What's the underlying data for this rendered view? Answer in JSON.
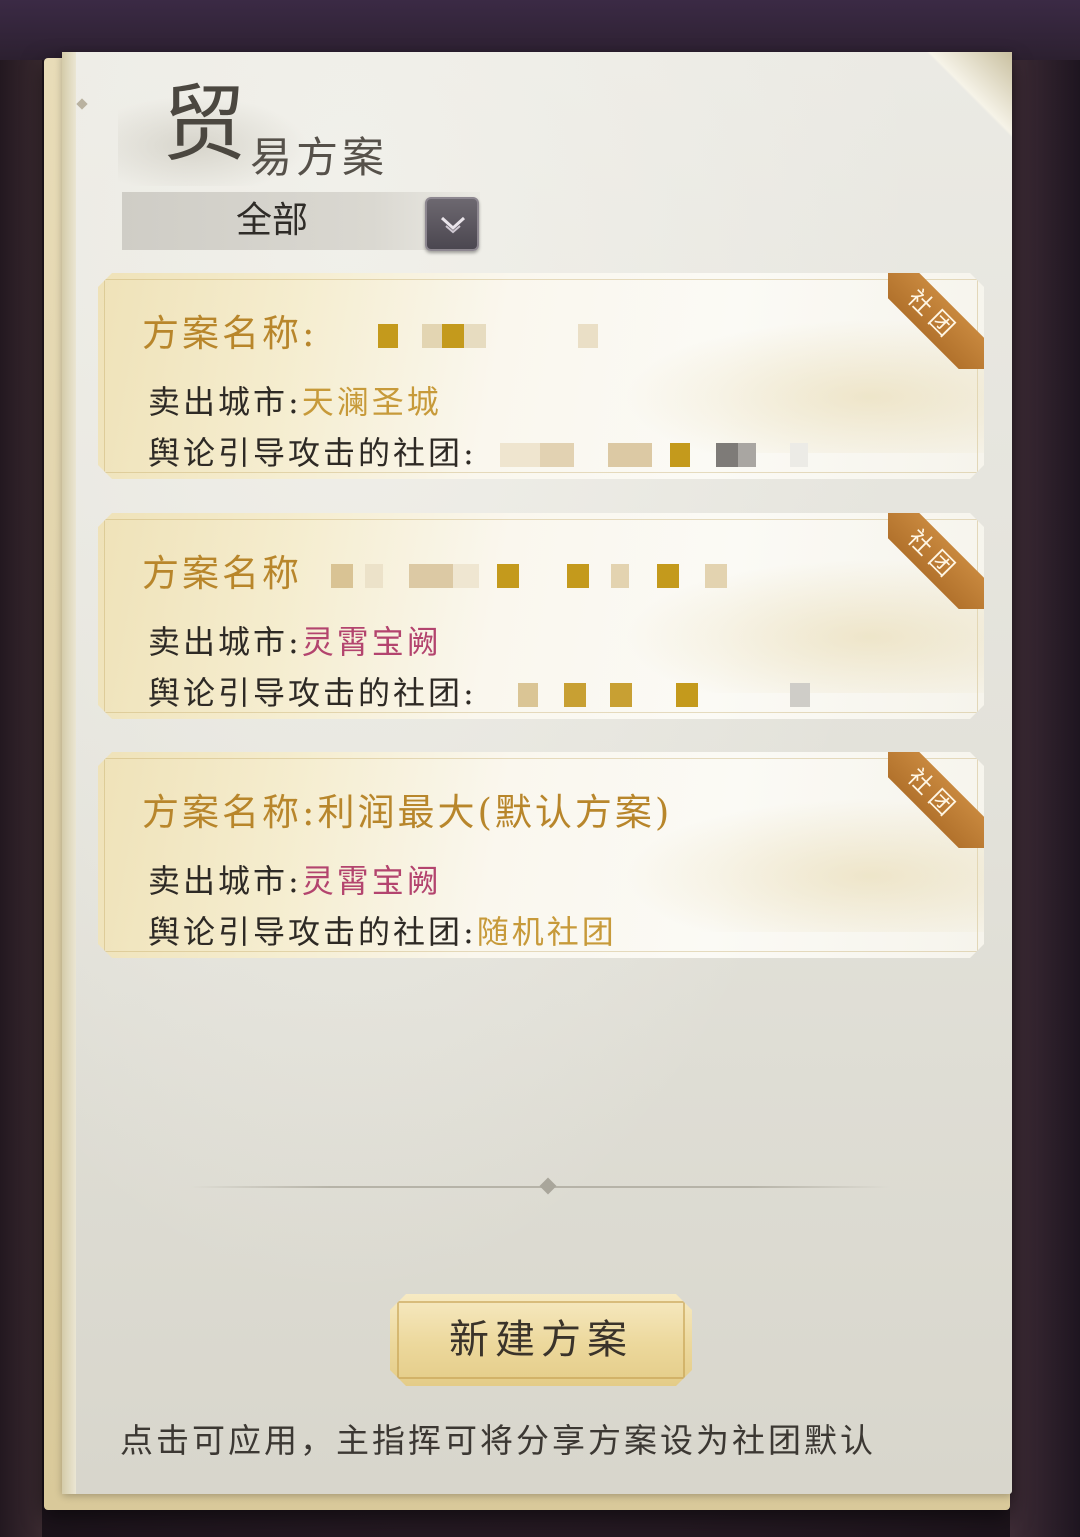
{
  "header": {
    "title_char": "贸",
    "title_rest": "易方案"
  },
  "filter": {
    "selected": "全部",
    "dropdown_icon": "chevron-down-icon"
  },
  "plans": [
    {
      "name_label": "方案名称:",
      "name_value": "",
      "badge": "社团",
      "sell_city_label": "卖出城市:",
      "sell_city": "天澜圣城",
      "target_label": "舆论引导攻击的社团:",
      "target_value": ""
    },
    {
      "name_label": "方案名称",
      "name_value": "",
      "badge": "社团",
      "sell_city_label": "卖出城市:",
      "sell_city": "灵霄宝阙",
      "target_label": "舆论引导攻击的社团:",
      "target_value": ""
    },
    {
      "name_label": "方案名称:",
      "name_value": "利润最大(默认方案)",
      "badge": "社团",
      "sell_city_label": "卖出城市:",
      "sell_city": "灵霄宝阙",
      "target_label": "舆论引导攻击的社团:",
      "target_value": "随机社团"
    }
  ],
  "actions": {
    "new_plan": "新建方案"
  },
  "footer": {
    "hint": "点击可应用，主指挥可将分享方案设为社团默认"
  },
  "colors": {
    "plan_name": "#b8862b",
    "city_tianlan": "#c79a3a",
    "city_lingxiao": "#b3446e",
    "badge": "#b8782e"
  }
}
